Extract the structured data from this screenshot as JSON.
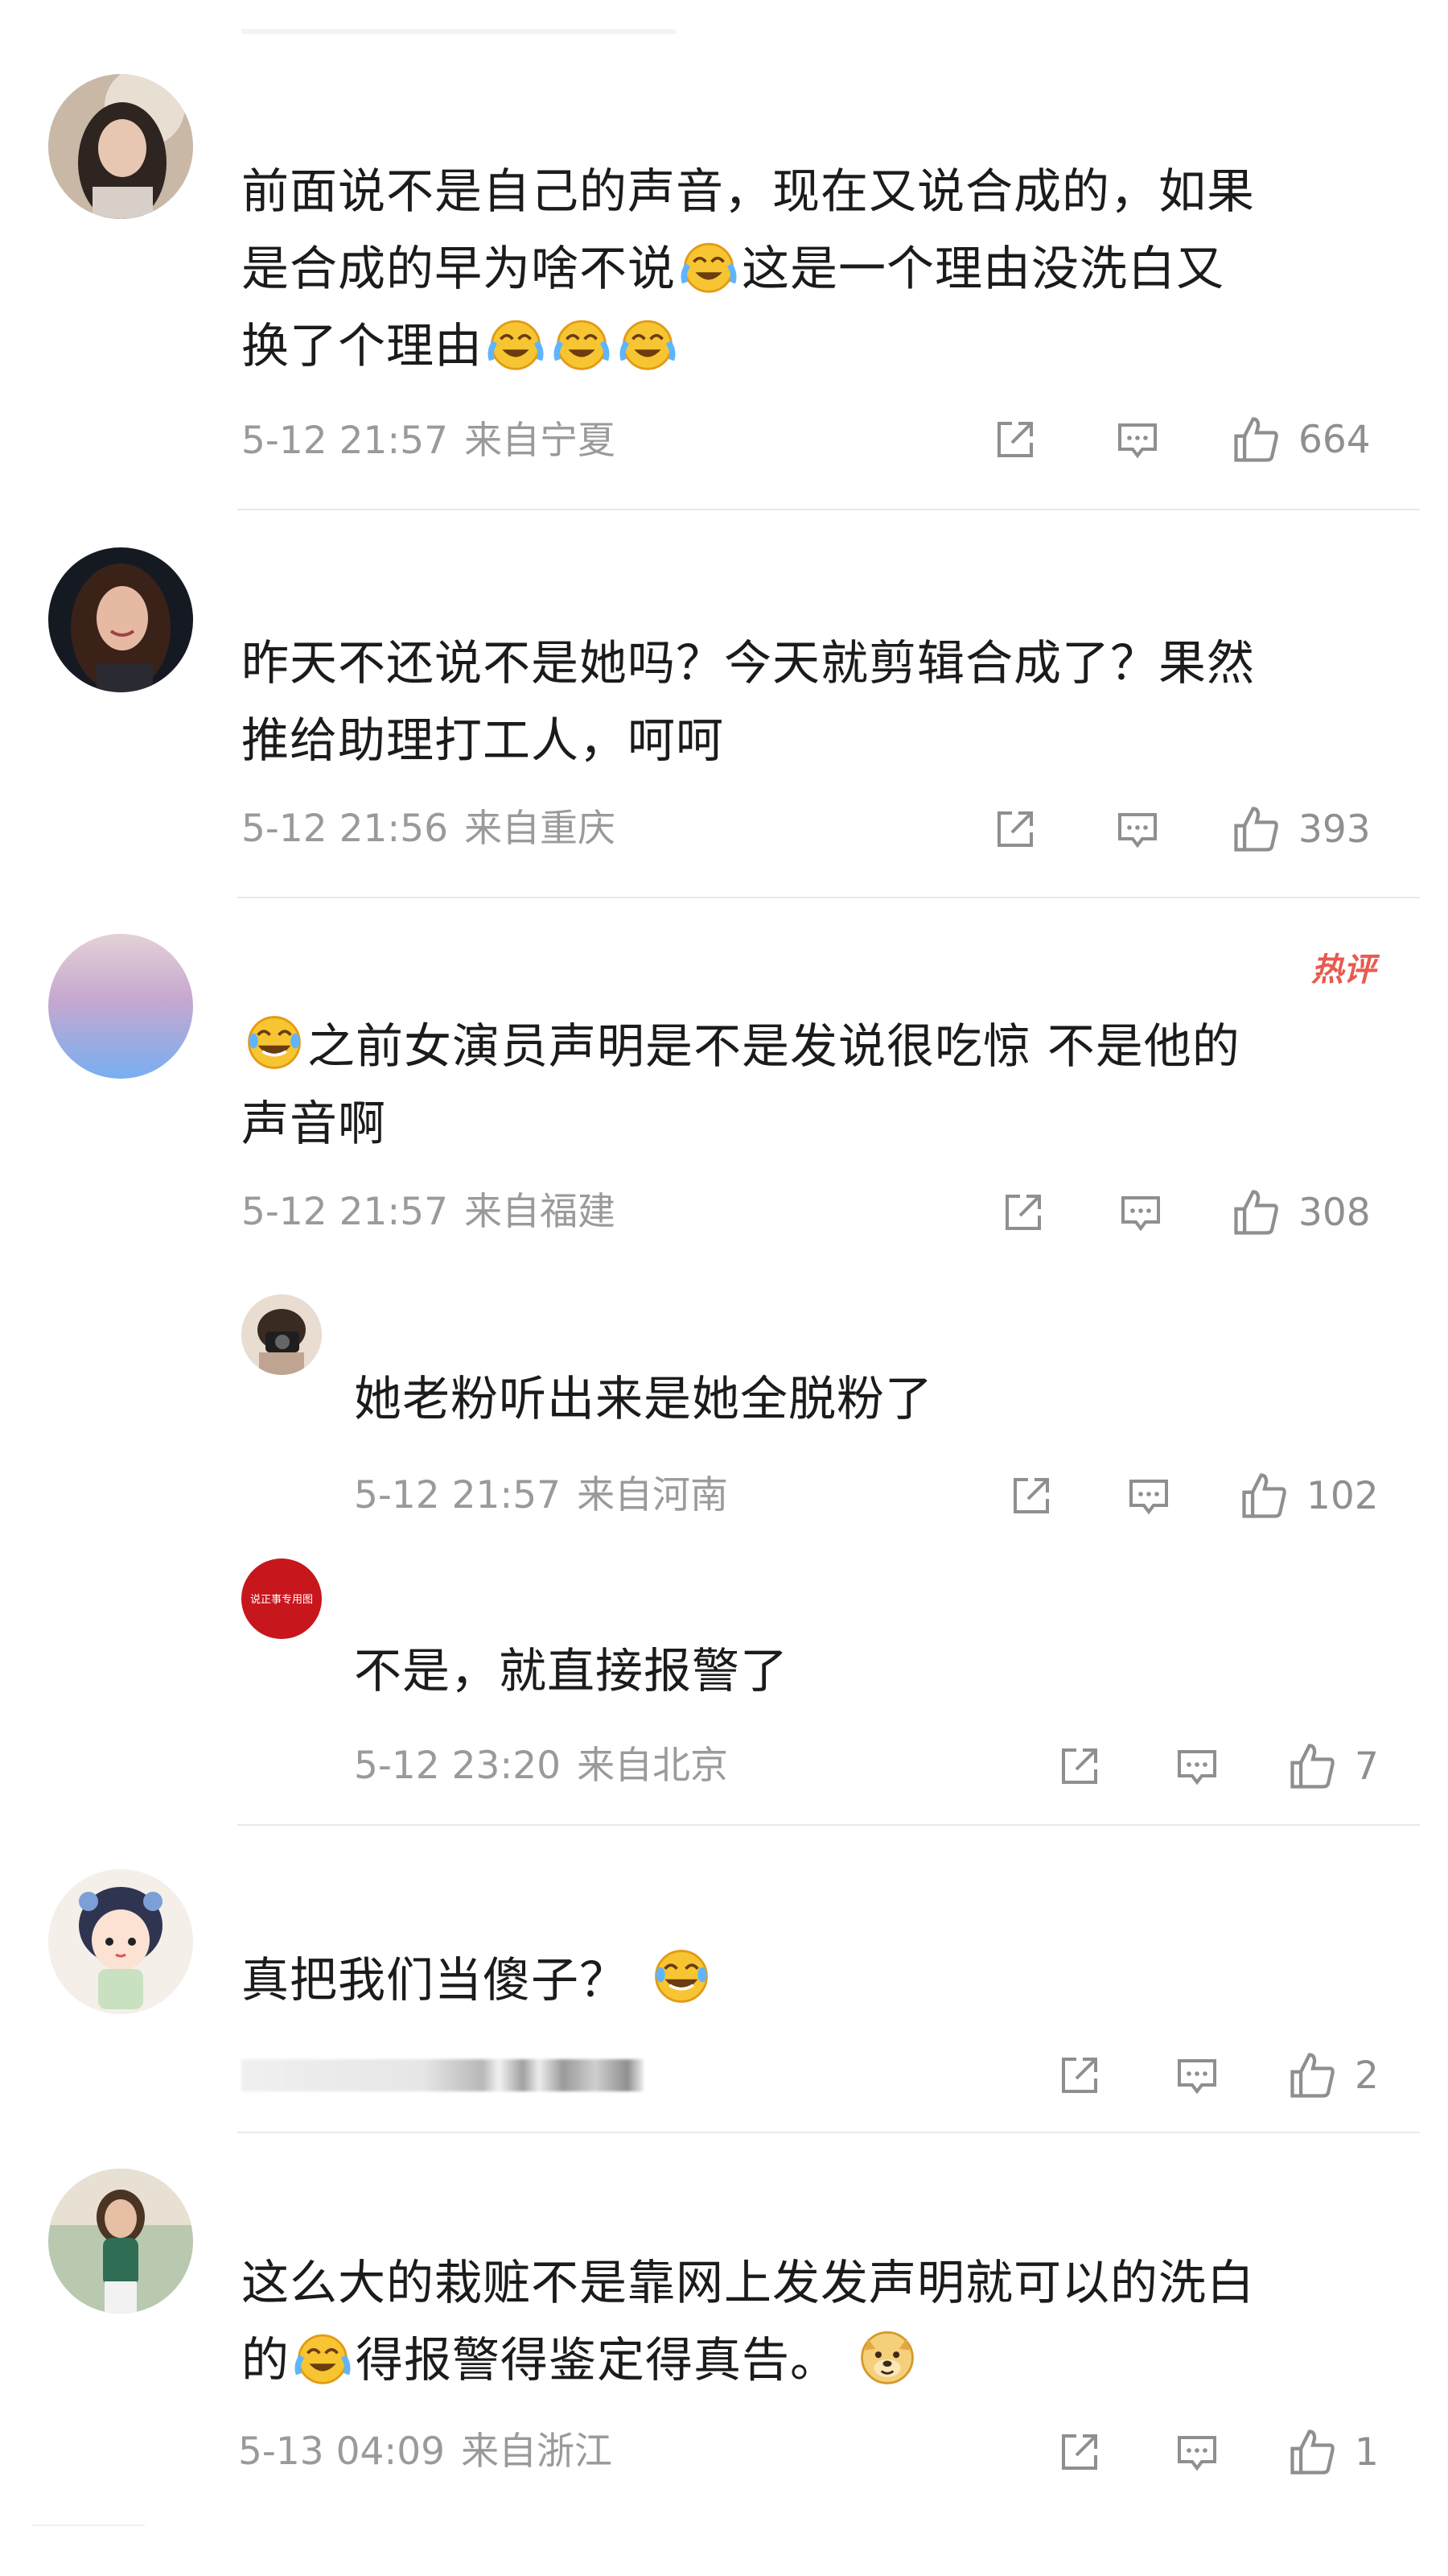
{
  "colors": {
    "text": "#1b1b1b",
    "meta": "#9a9a9a",
    "divider": "#e8e8e8",
    "hot": "#e85a4f"
  },
  "comments": [
    {
      "avatar": "avatar-girl-long-hair",
      "text_parts": [
        "前面说不是自己的声音，现在又说合成的，如果\n是合成的早为啥不说",
        "这是一个理由没洗白又\n换了个理由"
      ],
      "emojis": [
        "crying-laughing-emoji",
        "crying-laughing-emoji",
        "crying-laughing-emoji",
        "crying-laughing-emoji"
      ],
      "time": "5-12 21:57",
      "location": "来自宁夏",
      "likes": "664"
    },
    {
      "avatar": "avatar-woman-dark-hair",
      "text": "昨天不还说不是她吗？今天就剪辑合成了？果然\n推给助理打工人，呵呵",
      "time": "5-12 21:56",
      "location": "来自重庆",
      "likes": "393"
    },
    {
      "avatar": "avatar-gradient",
      "hot_label": "热评",
      "text": "之前女演员声明是不是发说很吃惊 不是他的\n声音啊",
      "emojis": [
        "laughing-tears-emoji"
      ],
      "time": "5-12 21:57",
      "location": "来自福建",
      "likes": "308",
      "replies": [
        {
          "avatar": "avatar-camera",
          "text": "她老粉听出来是她全脱粉了",
          "time": "5-12 21:57",
          "location": "来自河南",
          "likes": "102"
        },
        {
          "avatar": "avatar-red-badge",
          "avatar_text": "说正事专用图",
          "text": "不是，就直接报警了",
          "time": "5-12 23:20",
          "location": "来自北京",
          "likes": "7"
        }
      ]
    },
    {
      "avatar": "avatar-cartoon-girl",
      "text": "真把我们当傻子？",
      "emojis": [
        "laughing-tears-emoji"
      ],
      "likes": "2"
    },
    {
      "avatar": "avatar-woman-outdoor",
      "text_parts": [
        "这么大的栽赃不是靠网上发发声明就可以的洗白\n的",
        "得报警得鉴定得真告。"
      ],
      "emojis": [
        "crying-laughing-emoji",
        "doge-emoji"
      ],
      "time": "5-13 04:09",
      "location": "来自浙江",
      "likes": "1"
    }
  ]
}
